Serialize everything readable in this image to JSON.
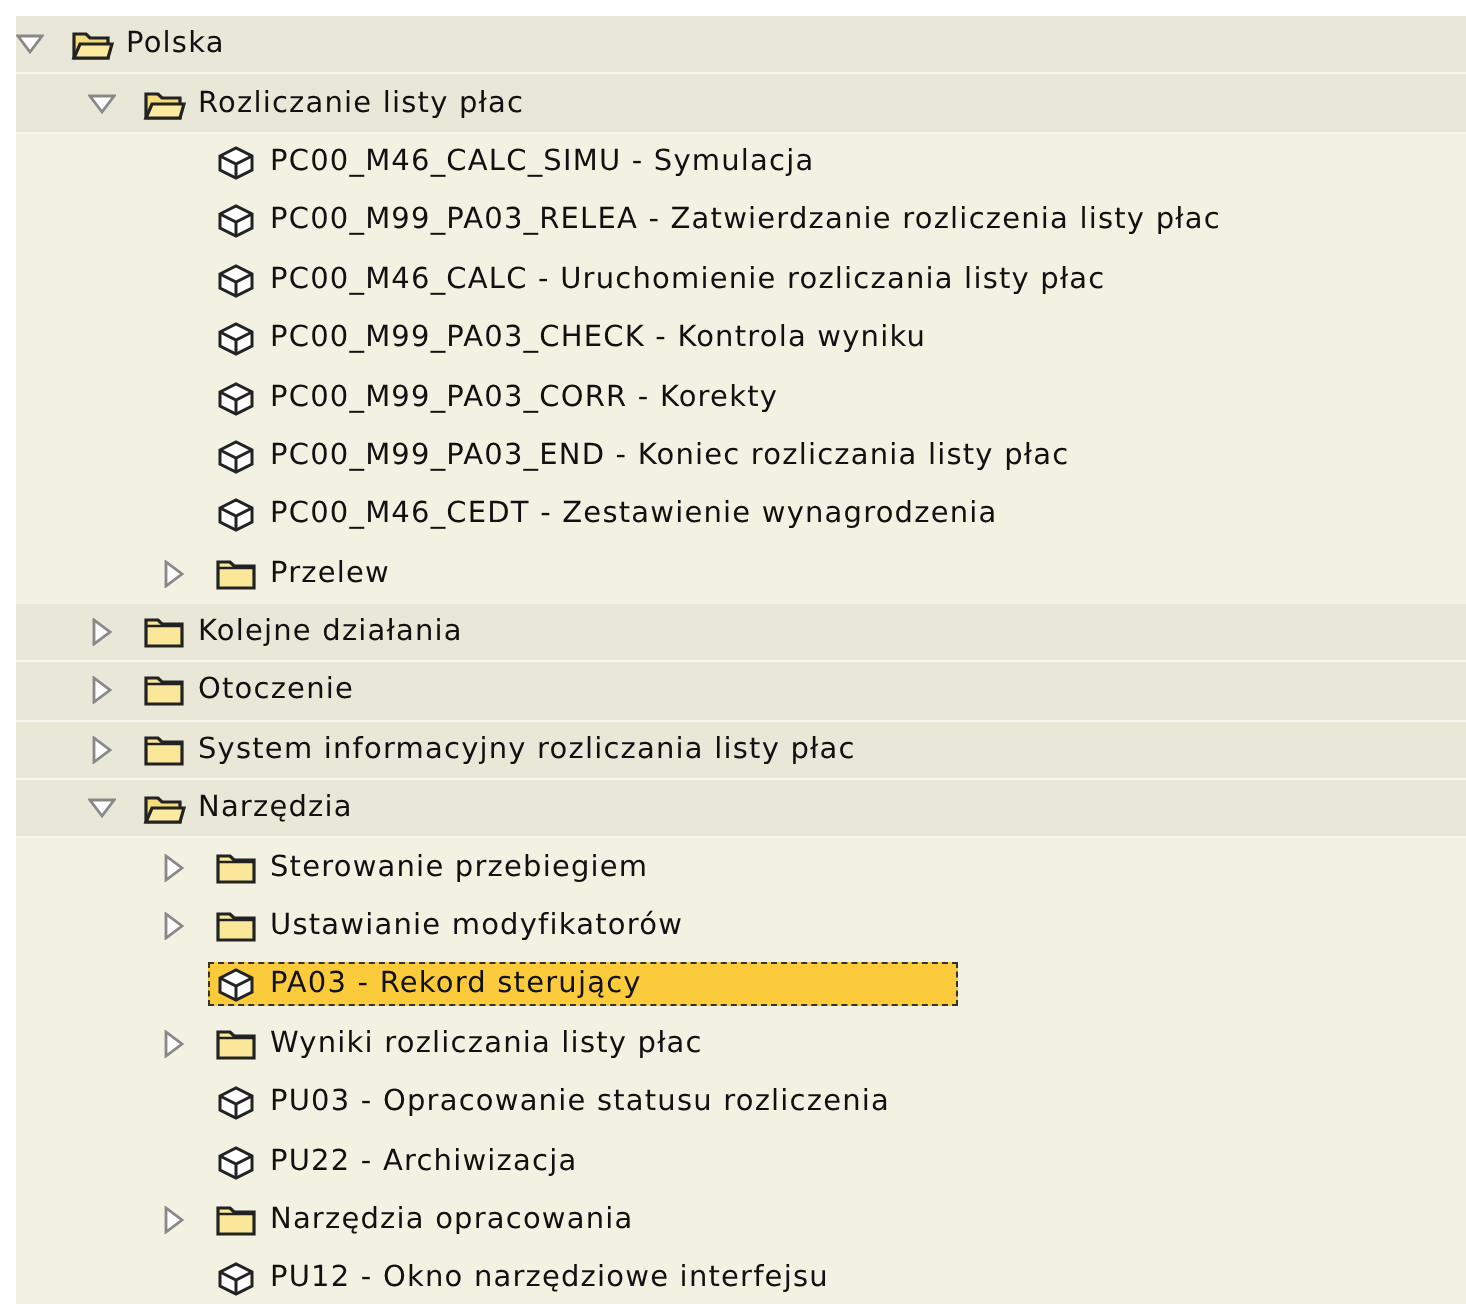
{
  "tree": [
    {
      "kind": "folder",
      "label": "Polska",
      "expanded": true,
      "selected": false,
      "children": [
        {
          "kind": "folder",
          "label": "Rozliczanie listy płac",
          "expanded": true,
          "selected": false,
          "children": [
            {
              "kind": "transaction",
              "label": "PC00_M46_CALC_SIMU - Symulacja",
              "selected": false
            },
            {
              "kind": "transaction",
              "label": "PC00_M99_PA03_RELEA - Zatwierdzanie rozliczenia listy płac",
              "selected": false
            },
            {
              "kind": "transaction",
              "label": "PC00_M46_CALC - Uruchomienie rozliczania listy płac",
              "selected": false
            },
            {
              "kind": "transaction",
              "label": "PC00_M99_PA03_CHECK - Kontrola wyniku",
              "selected": false
            },
            {
              "kind": "transaction",
              "label": "PC00_M99_PA03_CORR - Korekty",
              "selected": false
            },
            {
              "kind": "transaction",
              "label": "PC00_M99_PA03_END - Koniec rozliczania listy płac",
              "selected": false
            },
            {
              "kind": "transaction",
              "label": "PC00_M46_CEDT - Zestawienie wynagrodzenia",
              "selected": false
            },
            {
              "kind": "folder",
              "label": "Przelew",
              "expanded": false,
              "selected": false
            }
          ]
        },
        {
          "kind": "folder",
          "label": "Kolejne działania",
          "expanded": false,
          "selected": false
        },
        {
          "kind": "folder",
          "label": "Otoczenie",
          "expanded": false,
          "selected": false
        },
        {
          "kind": "folder",
          "label": "System informacyjny rozliczania listy płac",
          "expanded": false,
          "selected": false
        },
        {
          "kind": "folder",
          "label": "Narzędzia",
          "expanded": true,
          "selected": false,
          "children": [
            {
              "kind": "folder",
              "label": "Sterowanie przebiegiem",
              "expanded": false,
              "selected": false
            },
            {
              "kind": "folder",
              "label": "Ustawianie modyfikatorów",
              "expanded": false,
              "selected": false
            },
            {
              "kind": "transaction",
              "label": "PA03 - Rekord sterujący",
              "selected": true
            },
            {
              "kind": "folder",
              "label": "Wyniki rozliczania listy płac",
              "expanded": false,
              "selected": false
            },
            {
              "kind": "transaction",
              "label": "PU03 - Opracowanie statusu rozliczenia",
              "selected": false
            },
            {
              "kind": "transaction",
              "label": "PU22 - Archiwizacja",
              "selected": false
            },
            {
              "kind": "folder",
              "label": "Narzędzia opracowania",
              "expanded": false,
              "selected": false
            },
            {
              "kind": "transaction",
              "label": "PU12 - Okno narzędziowe interfejsu",
              "selected": false
            }
          ]
        }
      ]
    }
  ]
}
